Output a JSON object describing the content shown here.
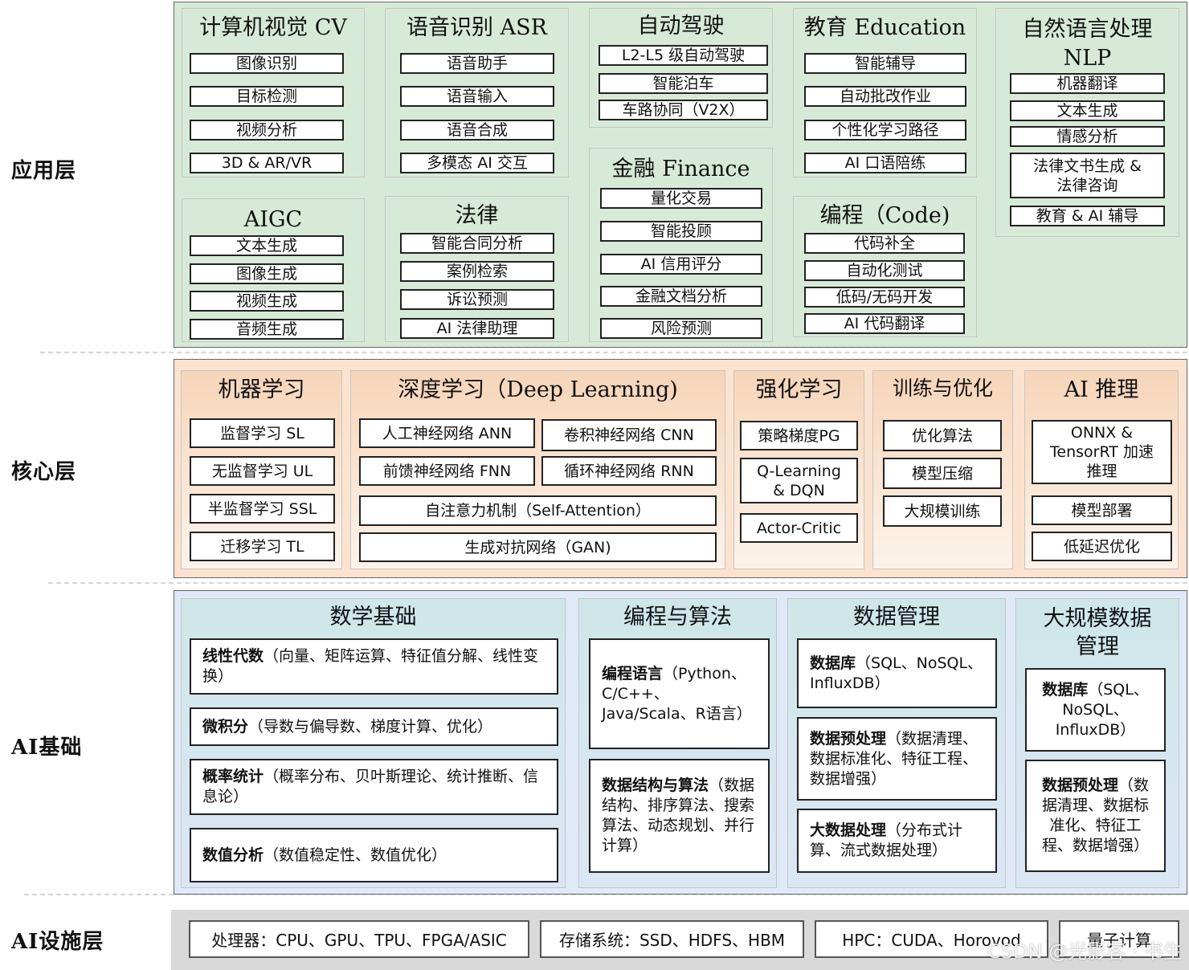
{
  "layers": {
    "app": "应用层",
    "core": "核心层",
    "base": "AI基础",
    "infra": "AI设施层"
  },
  "app": {
    "cv": {
      "title": "计算机视觉 CV",
      "items": [
        "图像识别",
        "目标检测",
        "视频分析",
        "3D & AR/VR"
      ]
    },
    "asr": {
      "title": "语音识别 ASR",
      "items": [
        "语音助手",
        "语音输入",
        "语音合成",
        "多模态 AI 交互"
      ]
    },
    "auto": {
      "title": "自动驾驶",
      "items": [
        "L2-L5 级自动驾驶",
        "智能泊车",
        "车路协同（V2X）"
      ]
    },
    "edu": {
      "title": "教育 Education",
      "items": [
        "智能辅导",
        "自动批改作业",
        "个性化学习路径",
        "AI 口语陪练"
      ]
    },
    "nlp": {
      "title": "自然语言处理\nNLP",
      "items": [
        "机器翻译",
        "文本生成",
        "情感分析",
        "法律文书生成 &\n法律咨询",
        "教育 & AI 辅导"
      ]
    },
    "aigc": {
      "title": "AIGC",
      "items": [
        "文本生成",
        "图像生成",
        "视频生成",
        "音频生成"
      ]
    },
    "law": {
      "title": "法律",
      "items": [
        "智能合同分析",
        "案例检索",
        "诉讼预测",
        "AI 法律助理"
      ]
    },
    "fin": {
      "title": "金融 Finance",
      "items": [
        "量化交易",
        "智能投顾",
        "AI 信用评分",
        "金融文档分析",
        "风险预测"
      ]
    },
    "code": {
      "title": "编程（Code)",
      "items": [
        "代码补全",
        "自动化测试",
        "低码/无码开发",
        "AI 代码翻译"
      ]
    }
  },
  "core": {
    "ml": {
      "title": "机器学习",
      "items": [
        "监督学习 SL",
        "无监督学习 UL",
        "半监督学习 SSL",
        "迁移学习 TL"
      ]
    },
    "dl": {
      "title": "深度学习（Deep Learning)",
      "items": [
        "人工神经网络 ANN",
        "卷积神经网络 CNN",
        "前馈神经网络 FNN",
        "循环神经网络 RNN",
        "自注意力机制（Self-Attention）",
        "生成对抗网络（GAN)"
      ]
    },
    "rl": {
      "title": "强化学习",
      "items": [
        "策略梯度PG",
        "Q-Learning\n& DQN",
        "Actor-Critic"
      ]
    },
    "train": {
      "title": "训练与优化",
      "items": [
        "优化算法",
        "模型压缩",
        "大规模训练"
      ]
    },
    "infer": {
      "title": "AI 推理",
      "items": [
        "ONNX &\nTensorRT 加速\n推理",
        "模型部署",
        "低延迟优化"
      ]
    }
  },
  "base": {
    "math": {
      "title": "数学基础",
      "items": [
        {
          "bold": "线性代数",
          "text": "（向量、矩阵运算、特征值分解、线性变换）"
        },
        {
          "bold": "微积分",
          "text": "（导数与偏导数、梯度计算、优化）"
        },
        {
          "bold": "概率统计",
          "text": "（概率分布、贝叶斯理论、统计推断、信息论）"
        },
        {
          "bold": "数值分析",
          "text": "（数值稳定性、数值优化）"
        }
      ]
    },
    "prog": {
      "title": "编程与算法",
      "items": [
        {
          "bold": "编程语言",
          "text": "（Python、C/C++、Java/Scala、R语言）"
        },
        {
          "bold": "数据结构与算法",
          "text": "（数据结构、排序算法、搜索算法、动态规划、并行计算）"
        }
      ]
    },
    "data": {
      "title": "数据管理",
      "items": [
        {
          "bold": "数据库",
          "text": "（SQL、NoSQL、InfluxDB）"
        },
        {
          "bold": "数据预处理",
          "text": "（数据清理、数据标准化、特征工程、数据增强）"
        },
        {
          "bold": "大数据处理",
          "text": "（分布式计算、流式数据处理）"
        }
      ]
    },
    "big": {
      "title": "大规模数据\n管理",
      "items": [
        {
          "bold": "数据库",
          "text": "（SQL、NoSQL、InfluxDB）"
        },
        {
          "bold": "数据预处理",
          "text": "（数据清理、数据标准化、特征工程、数据增强）"
        }
      ]
    }
  },
  "infra": {
    "items": [
      "处理器：CPU、GPU、TPU、FPGA/ASIC",
      "存储系统：SSD、HDFS、HBM",
      "HPC：CUDA、Horovod",
      "量子计算"
    ]
  },
  "watermark": "CSDN @光影客 · 书生",
  "colors": {
    "app_bg": "#d7ead8",
    "core_bg": "#f6d5b9",
    "base_bg": "#cfe7e9",
    "infra_bg": "#d9d9d9"
  }
}
